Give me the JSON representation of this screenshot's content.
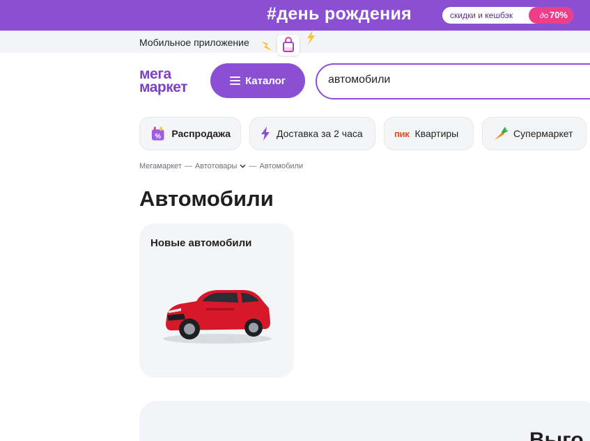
{
  "promo": {
    "title": "#день рождения",
    "pill_text": "скидки и кешбэк",
    "discount_prefix": "до",
    "discount_value": "70%"
  },
  "app_strip": {
    "text": "Мобильное приложение"
  },
  "header": {
    "logo_line1": "мега",
    "logo_line2": "маркет",
    "catalog_label": "Каталог",
    "search_value": "автомобили"
  },
  "chips": [
    {
      "label": "Распродажа",
      "icon": "sale-calendar-icon"
    },
    {
      "label": "Доставка за 2 часа",
      "icon": "lightning-icon"
    },
    {
      "label": "Квартиры",
      "brand": "пик"
    },
    {
      "label": "Супермаркет",
      "icon": "carrot-icon"
    }
  ],
  "breadcrumbs": {
    "items": [
      "Мегамаркет",
      "Автотовары",
      "Автомобили"
    ],
    "separator": "—"
  },
  "page": {
    "title": "Автомобили"
  },
  "categories": [
    {
      "title": "Новые автомобили",
      "image": "red-suv-image"
    }
  ],
  "bottom": {
    "partial_heading": "Выго"
  },
  "colors": {
    "brand_purple": "#8a4fd3",
    "discount_pink": "#ef3d8a",
    "pik_orange": "#ef4a1a",
    "car_red": "#d7182a"
  }
}
